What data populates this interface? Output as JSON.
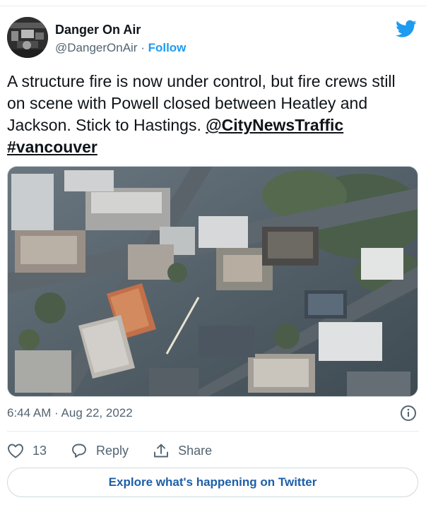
{
  "account": {
    "name": "Danger On Air",
    "handle": "@DangerOnAir",
    "separator": " · ",
    "follow_label": "Follow"
  },
  "tweet": {
    "text": "A structure fire is now under control, but fire crews still on scene with Powell closed between Heatley and Jackson. Stick to Hastings. ",
    "mention": "@CityNewsTraffic",
    "hashtag": "#vancouver",
    "timestamp": "6:44 AM · Aug 22, 2022"
  },
  "media": {
    "icon": "aerial-photo"
  },
  "actions": {
    "like_count": "13",
    "reply_label": "Reply",
    "share_label": "Share"
  },
  "explore_label": "Explore what's happening on Twitter",
  "colors": {
    "brand": "#1d9bf0",
    "text": "#0f1419",
    "secondary": "#536471",
    "border": "#cfd9de"
  }
}
